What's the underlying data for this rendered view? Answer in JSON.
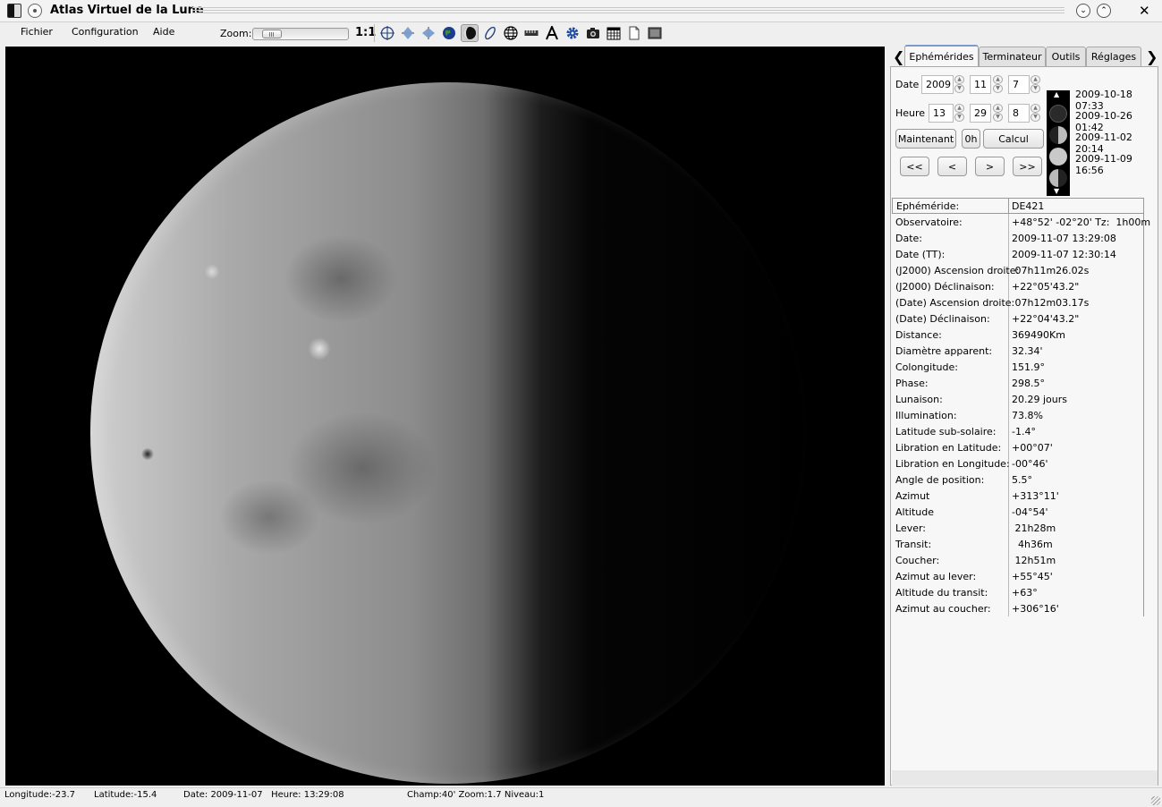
{
  "window": {
    "title": "Atlas Virtuel de la Lune"
  },
  "menu": {
    "file": "Fichier",
    "config": "Configuration",
    "help": "Aide"
  },
  "toolbar": {
    "zoom_label": "Zoom:",
    "zoom_11": "1:1"
  },
  "tabs": [
    "Ephémérides",
    "Terminateur",
    "Outils",
    "Réglages"
  ],
  "ephem": {
    "date_label": "Date",
    "date_year": "2009",
    "date_month": "11",
    "date_day": "7",
    "time_label": "Heure",
    "time_hour": "13",
    "time_min": "29",
    "time_sec": "8",
    "now_button": "Maintenant",
    "zero_button": "0h",
    "calc_button": "Calcul",
    "nav": [
      "<<",
      "<",
      ">",
      ">>"
    ],
    "phases": [
      "2009-10-18 07:33",
      "2009-10-26 01:42",
      "2009-11-02 20:14",
      "2009-11-09 16:56"
    ],
    "table_header": {
      "key": "Ephéméride:",
      "value": "DE421"
    },
    "rows": [
      {
        "k": "Observatoire:",
        "v": "+48°52' -02°20' Tz:  1h00m"
      },
      {
        "k": "Date:",
        "v": "2009-11-07 13:29:08"
      },
      {
        "k": "Date (TT):",
        "v": "2009-11-07 12:30:14"
      },
      {
        "k": "(J2000) Ascension droite:",
        "v": " 07h11m26.02s"
      },
      {
        "k": "(J2000) Déclinaison:",
        "v": "+22°05'43.2\""
      },
      {
        "k": "(Date) Ascension droite:",
        "v": " 07h12m03.17s"
      },
      {
        "k": "(Date) Déclinaison:",
        "v": "+22°04'43.2\""
      },
      {
        "k": "Distance:",
        "v": "369490Km"
      },
      {
        "k": "Diamètre apparent:",
        "v": "32.34'"
      },
      {
        "k": "Colongitude:",
        "v": "151.9°"
      },
      {
        "k": "Phase:",
        "v": "298.5°"
      },
      {
        "k": "Lunaison:",
        "v": "20.29 jours"
      },
      {
        "k": "Illumination:",
        "v": "73.8%"
      },
      {
        "k": "Latitude sub-solaire:",
        "v": "-1.4°"
      },
      {
        "k": "Libration en Latitude:",
        "v": "+00°07'"
      },
      {
        "k": "Libration en Longitude:",
        "v": "-00°46'"
      },
      {
        "k": "Angle de position:",
        "v": "5.5°"
      },
      {
        "k": "Azimut",
        "v": "+313°11'"
      },
      {
        "k": "Altitude",
        "v": "-04°54'"
      },
      {
        "k": "Lever:",
        "v": " 21h28m"
      },
      {
        "k": "Transit:",
        "v": "  4h36m"
      },
      {
        "k": "Coucher:",
        "v": " 12h51m"
      },
      {
        "k": "Azimut au lever:",
        "v": "+55°45'"
      },
      {
        "k": "Altitude du transit:",
        "v": "+63°"
      },
      {
        "k": "Azimut au coucher:",
        "v": "+306°16'"
      }
    ]
  },
  "status": {
    "longitude": "Longitude:-23.7",
    "latitude": "Latitude:-15.4",
    "datetime": "Date: 2009-11-07   Heure: 13:29:08",
    "field": "Champ:40' Zoom:1.7  Niveau:1"
  }
}
